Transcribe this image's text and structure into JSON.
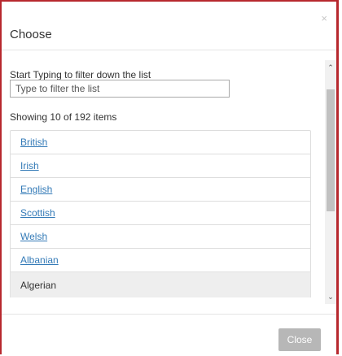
{
  "modal": {
    "title": "Choose",
    "close_glyph": "×"
  },
  "filter": {
    "label": "Start Typing to filter down the list",
    "placeholder": "Type to filter the list",
    "value": ""
  },
  "results": {
    "count_text": "Showing 10 of 192 items",
    "items": [
      {
        "label": "British",
        "active": false
      },
      {
        "label": "Irish",
        "active": false
      },
      {
        "label": "English",
        "active": false
      },
      {
        "label": "Scottish",
        "active": false
      },
      {
        "label": "Welsh",
        "active": false
      },
      {
        "label": "Albanian",
        "active": false
      },
      {
        "label": "Algerian",
        "active": true
      }
    ]
  },
  "scrollbar": {
    "up_icon": "chevron-up-icon",
    "down_icon": "chevron-down-icon",
    "up_glyph": "⌃",
    "down_glyph": "⌄"
  },
  "footer": {
    "close_label": "Close"
  },
  "colors": {
    "accent_border": "#b7282e",
    "link": "#337ab7",
    "button_disabled": "#b7b7b7"
  }
}
